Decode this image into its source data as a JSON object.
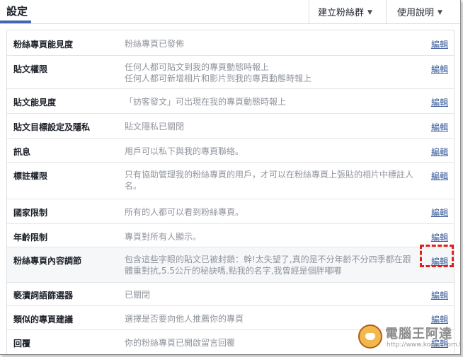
{
  "header": {
    "title": "設定",
    "create_group": "建立粉絲群",
    "help": "使用說明"
  },
  "rows": [
    {
      "label": "粉絲專頁能見度",
      "desc": "粉絲專頁已發佈",
      "edit": "編輯"
    },
    {
      "label": "貼文權限",
      "desc": "任何人都可貼文到我的專頁動態時報上\n任何人都可新增相片和影片到我的專頁動態時報上",
      "edit": "編輯"
    },
    {
      "label": "貼文能見度",
      "desc": "「訪客發文」可出現在我的專頁動態時報上",
      "edit": "編輯"
    },
    {
      "label": "貼文目標設定及隱私",
      "desc": "貼文隱私已關閉",
      "edit": "編輯"
    },
    {
      "label": "訊息",
      "desc": "用戶可以私下與我的專頁聯絡。",
      "edit": "編輯"
    },
    {
      "label": "標註權限",
      "desc": "只有協助管理我的粉絲專頁的用戶，才可以在粉絲專頁上張貼的相片中標註人名。",
      "edit": "編輯"
    },
    {
      "label": "國家限制",
      "desc": "所有的人都可以看到粉絲專頁。",
      "edit": "編輯"
    },
    {
      "label": "年齡限制",
      "desc": "專頁對所有人顯示。",
      "edit": "編輯"
    },
    {
      "label": "粉絲專頁內容調節",
      "desc": "包含這些字眼的貼文已被封鎖：幹!太失望了,真的是不分年齡不分四季都在跟體重對抗,5.5公斤的秘訣嗎,點我的名字,我曾經是個胖嘟嘟",
      "edit": "編輯"
    },
    {
      "label": "褻瀆詞語篩選器",
      "desc": "已關閉",
      "edit": "編輯"
    },
    {
      "label": "類似的專頁建議",
      "desc": "選擇是否要向他人推薦你的專頁",
      "edit": "編輯"
    },
    {
      "label": "回覆",
      "desc": "你的粉絲專頁已開啟留言回覆",
      "edit": "編輯"
    }
  ],
  "watermark": {
    "title": "電腦王阿達",
    "url": "http://www.kocpc.com.tw"
  },
  "colors": {
    "link": "#365899",
    "highlight_box": "#e0201b",
    "tab_underline": "#4267b2"
  }
}
